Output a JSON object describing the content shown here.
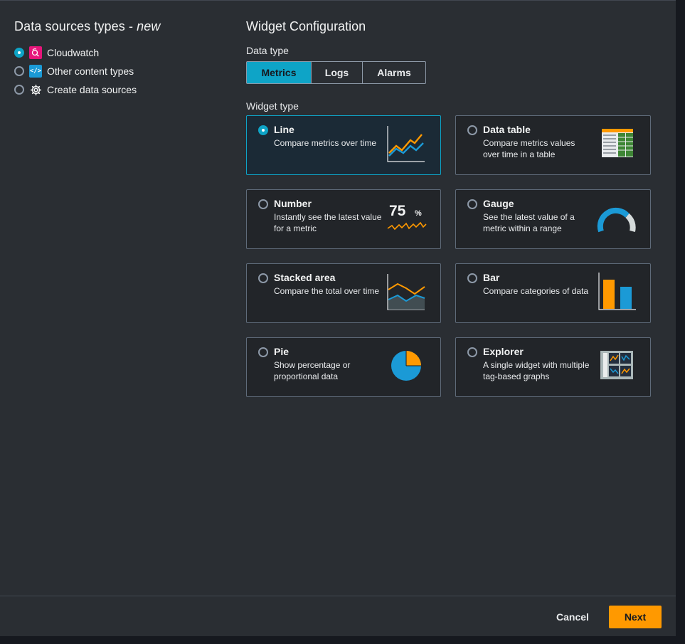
{
  "left": {
    "title": "Data sources types - ",
    "title_em": "new",
    "sources": [
      {
        "label": "Cloudwatch",
        "selected": true,
        "icon": "cloudwatch-icon"
      },
      {
        "label": "Other content types",
        "selected": false,
        "icon": "code-icon"
      },
      {
        "label": "Create data sources",
        "selected": false,
        "icon": "gear-icon"
      }
    ]
  },
  "right": {
    "title": "Widget Configuration",
    "data_type_label": "Data type",
    "data_types": [
      "Metrics",
      "Logs",
      "Alarms"
    ],
    "data_type_selected": "Metrics",
    "widget_type_label": "Widget type",
    "widgets": [
      {
        "title": "Line",
        "desc": "Compare metrics over time",
        "selected": true,
        "icon": "line-chart-icon"
      },
      {
        "title": "Data table",
        "desc": "Compare metrics values over time in a table",
        "selected": false,
        "icon": "data-table-icon"
      },
      {
        "title": "Number",
        "desc": "Instantly see the latest value for a metric",
        "selected": false,
        "icon": "number-icon",
        "icon_value": "75",
        "icon_unit": "%"
      },
      {
        "title": "Gauge",
        "desc": "See the latest value of a metric within a range",
        "selected": false,
        "icon": "gauge-icon"
      },
      {
        "title": "Stacked area",
        "desc": "Compare the total over time",
        "selected": false,
        "icon": "stacked-area-icon"
      },
      {
        "title": "Bar",
        "desc": "Compare categories of data",
        "selected": false,
        "icon": "bar-chart-icon"
      },
      {
        "title": "Pie",
        "desc": "Show percentage or proportional data",
        "selected": false,
        "icon": "pie-chart-icon"
      },
      {
        "title": "Explorer",
        "desc": "A single widget with multiple tag-based graphs",
        "selected": false,
        "icon": "explorer-icon"
      }
    ]
  },
  "footer": {
    "cancel_label": "Cancel",
    "next_label": "Next"
  },
  "colors": {
    "accent": "#0ea4c7",
    "primary_button": "#ff9900",
    "chart_orange": "#ff9900",
    "chart_blue": "#1b9ad6"
  }
}
